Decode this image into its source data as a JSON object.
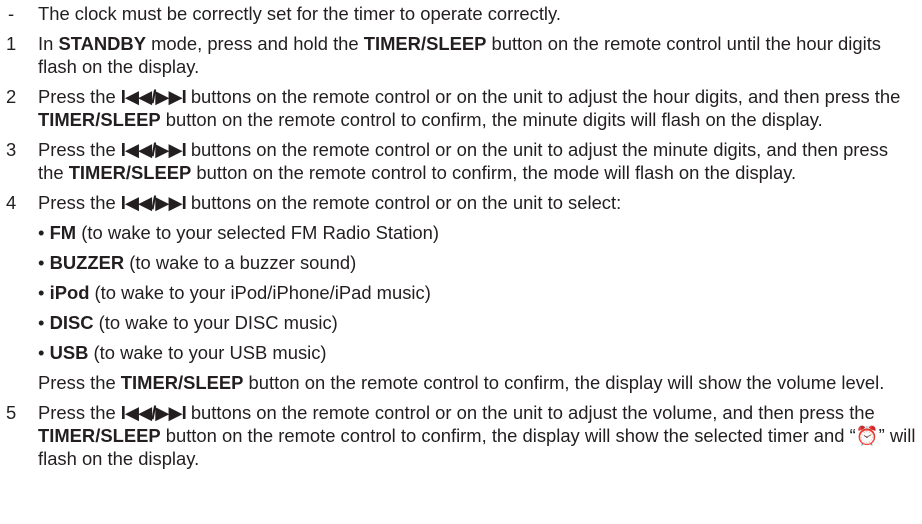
{
  "note": "The clock must be correctly set for the timer to operate correctly.",
  "steps": [
    {
      "num": "1",
      "parts": [
        "In ",
        "STANDBY",
        " mode, press and hold the ",
        "TIMER/SLEEP",
        " button on the remote control until the hour digits flash on the display."
      ]
    },
    {
      "num": "2",
      "parts": [
        "Press the ",
        "I◀◀/▶▶I",
        " buttons on the remote control or on the unit to adjust the hour digits, and then press the ",
        "TIMER/SLEEP",
        " button on the remote control to confirm, the minute digits will flash on the display."
      ]
    },
    {
      "num": "3",
      "parts": [
        "Press the ",
        "I◀◀/▶▶I",
        " buttons on the remote control or on the unit to adjust the minute digits, and then press the ",
        "TIMER/SLEEP",
        " button on the remote control to confirm, the mode will flash on the display."
      ]
    },
    {
      "num": "4",
      "parts": [
        "Press the ",
        "I◀◀/▶▶I",
        " buttons on the remote control or on the unit to select:"
      ],
      "options": [
        {
          "bullet": "•",
          "name": "FM",
          "desc": " (to wake to your selected FM Radio Station)"
        },
        {
          "bullet": "•",
          "name": "BUZZER",
          "desc": " (to wake to a buzzer sound)"
        },
        {
          "bullet": "•",
          "name": "iPod",
          "desc": " (to wake to your iPod/iPhone/iPad music)"
        },
        {
          "bullet": "•",
          "name": "DISC",
          "desc": " (to wake to your DISC music)"
        },
        {
          "bullet": "•",
          "name": "USB",
          "desc": " (to wake to your USB music)"
        }
      ],
      "after_parts": [
        "Press the ",
        "TIMER/SLEEP",
        " button on the remote control to confirm, the display will show the volume level."
      ]
    },
    {
      "num": "5",
      "parts": [
        "Press the ",
        "I◀◀/▶▶I",
        " buttons on the remote control or on the unit to adjust the volume, and then press the ",
        "TIMER/SLEEP",
        " button on the remote control to confirm, the display will show the selected timer and “",
        "⏰",
        "” will flash on the display."
      ]
    }
  ]
}
